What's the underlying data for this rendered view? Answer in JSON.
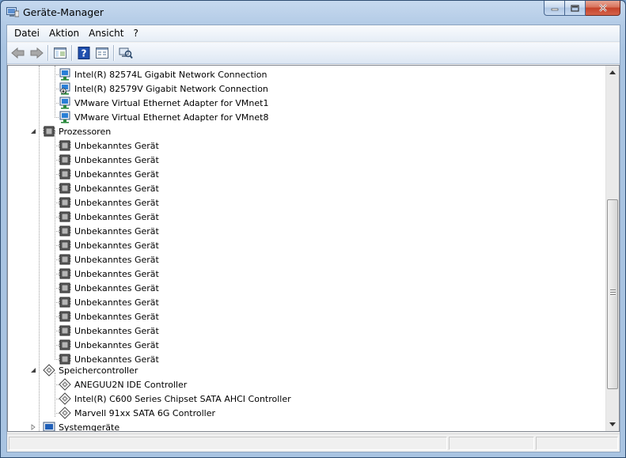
{
  "window": {
    "title": "Geräte-Manager"
  },
  "menu": [
    "Datei",
    "Aktion",
    "Ansicht",
    "?"
  ],
  "toolbar": [
    "back-icon",
    "forward-icon",
    "show-hide-console-tree-icon",
    "help-icon",
    "properties-icon",
    "scan-hardware-icon"
  ],
  "tree": {
    "network_items": [
      "Intel(R) 82574L Gigabit Network Connection",
      "Intel(R) 82579V Gigabit Network Connection",
      "VMware Virtual Ethernet Adapter for VMnet1",
      "VMware Virtual Ethernet Adapter for VMnet8"
    ],
    "processors": {
      "label": "Prozessoren",
      "children": [
        "Unbekanntes Gerät",
        "Unbekanntes Gerät",
        "Unbekanntes Gerät",
        "Unbekanntes Gerät",
        "Unbekanntes Gerät",
        "Unbekanntes Gerät",
        "Unbekanntes Gerät",
        "Unbekanntes Gerät",
        "Unbekanntes Gerät",
        "Unbekanntes Gerät",
        "Unbekanntes Gerät",
        "Unbekanntes Gerät",
        "Unbekanntes Gerät",
        "Unbekanntes Gerät",
        "Unbekanntes Gerät",
        "Unbekanntes Gerät"
      ]
    },
    "storage": {
      "label": "Speichercontroller",
      "children": [
        "ANEGUU2N IDE Controller",
        "Intel(R) C600 Series Chipset SATA AHCI Controller",
        "Marvell 91xx SATA 6G Controller"
      ]
    },
    "system": {
      "label": "Systemgeräte"
    }
  },
  "colors": {
    "selection": "#3399ff",
    "titlebar": "#b3cbe6",
    "close_button": "#c4432a"
  }
}
